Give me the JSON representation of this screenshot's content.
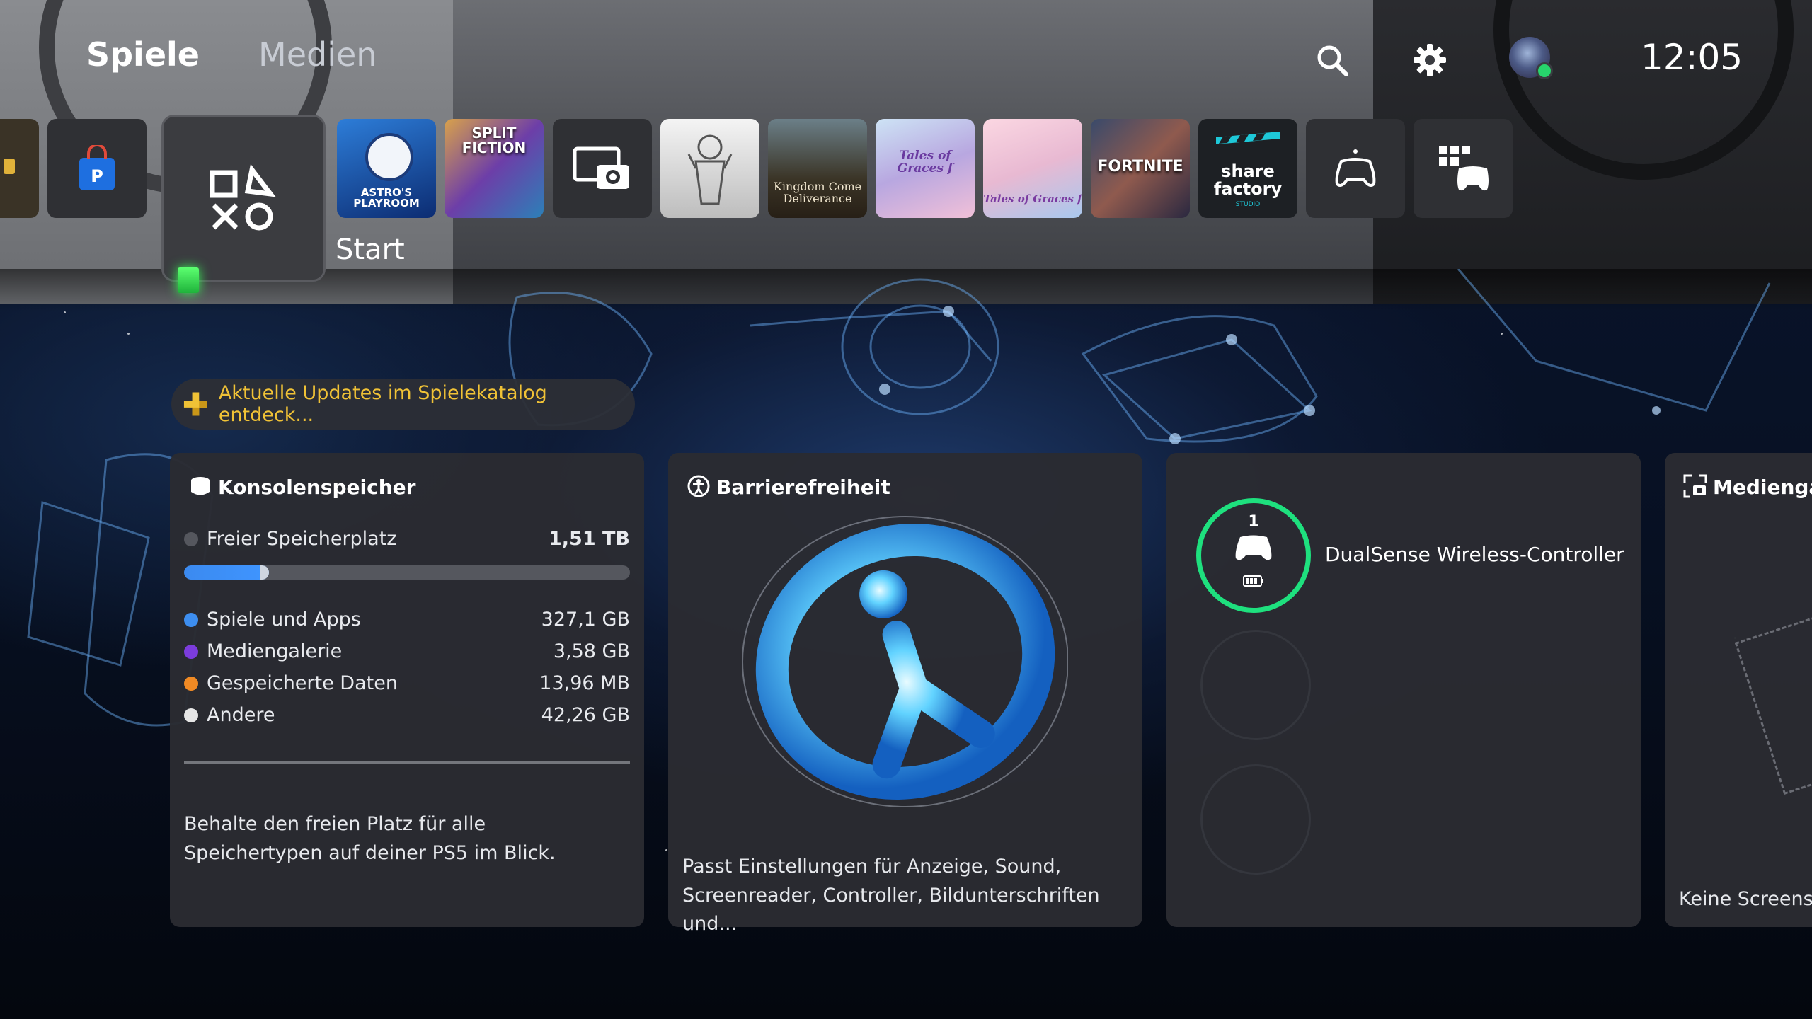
{
  "header": {
    "tabs": [
      {
        "label": "Spiele",
        "active": true
      },
      {
        "label": "Medien",
        "active": false
      }
    ],
    "icons": [
      "search-icon",
      "settings-gear-icon"
    ],
    "clock": "12:05",
    "avatar_status": "online"
  },
  "tiles": {
    "items": [
      {
        "name": "partial-left-tile"
      },
      {
        "name": "playstation-store"
      },
      {
        "name": "game-base-start",
        "label": "Start",
        "selected": true
      },
      {
        "name": "astro-playroom",
        "text": "ASTRO'S PLAYROOM"
      },
      {
        "name": "split-fiction",
        "text": "SPLIT FICTION"
      },
      {
        "name": "media-gallery"
      },
      {
        "name": "game-white-art"
      },
      {
        "name": "kingdom-come-deliverance",
        "text": "Kingdom Come Deliverance"
      },
      {
        "name": "tales-of-graces",
        "text": "Tales of Graces f"
      },
      {
        "name": "tales-of-graces-2",
        "text": "Tales of Graces f"
      },
      {
        "name": "fortnite",
        "text": "FORTNITE"
      },
      {
        "name": "share-factory",
        "text": "share factory",
        "sub": "STUDIO"
      },
      {
        "name": "remote-play"
      },
      {
        "name": "game-library"
      }
    ]
  },
  "notification": {
    "text": "Aktuelle Updates im Spielekatalog entdeck..."
  },
  "storage_card": {
    "title": "Konsolenspeicher",
    "free_label": "Freier Speicherplatz",
    "free_value": "1,51 TB",
    "used_fraction": 0.19,
    "items": [
      {
        "label": "Spiele und Apps",
        "value": "327,1 GB",
        "color": "#3d8ef0"
      },
      {
        "label": "Mediengalerie",
        "value": "3,58 GB",
        "color": "#7c3cdc"
      },
      {
        "label": "Gespeicherte Daten",
        "value": "13,96 MB",
        "color": "#f08a24"
      },
      {
        "label": "Andere",
        "value": "42,26 GB",
        "color": "#e6e6e6"
      }
    ],
    "description": "Behalte den freien Platz für alle Speichertypen auf deiner PS5 im Blick."
  },
  "accessibility_card": {
    "title": "Barrierefreiheit",
    "description": "Passt Einstellungen für Anzeige, Sound, Screenreader, Controller, Bildunterschriften und..."
  },
  "controller_card": {
    "player_number": "1",
    "name": "DualSense Wireless-Controller",
    "accent": "#1ee07e"
  },
  "media_card": {
    "title": "Medienga",
    "description": "Keine Screensh"
  }
}
